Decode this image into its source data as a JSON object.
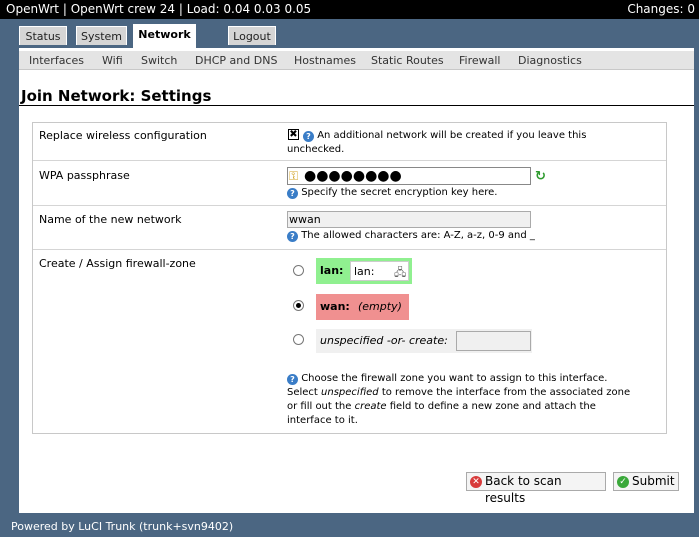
{
  "header": {
    "title": "OpenWrt | OpenWrt crew 24 | Load: 0.04 0.03 0.05",
    "changes": "Changes: 0"
  },
  "tabs": [
    {
      "label": "Status",
      "active": false
    },
    {
      "label": "System",
      "active": false
    },
    {
      "label": "Network",
      "active": true
    },
    {
      "label": "Logout",
      "active": false
    }
  ],
  "subnav": [
    "Interfaces",
    "Wifi",
    "Switch",
    "DHCP and DNS",
    "Hostnames",
    "Static Routes",
    "Firewall",
    "Diagnostics"
  ],
  "page_title": "Join Network: Settings",
  "form": {
    "replace": {
      "label": "Replace wireless configuration",
      "checked": true,
      "check_mark": "✖",
      "help_line1": "An additional network will be created if you leave this",
      "help_line2": "unchecked."
    },
    "wpa": {
      "label": "WPA passphrase",
      "value_masked": "●●●●●●●●",
      "help": "Specify the secret encryption key here."
    },
    "network_name": {
      "label": "Name of the new network",
      "value": "wwan",
      "help": "The allowed characters are: A-Z, a-z, 0-9 and _"
    },
    "firewall": {
      "label": "Create / Assign firewall-zone",
      "lan_label": "lan:",
      "lan_value": "lan:",
      "wan_label": "wan:",
      "wan_value": "(empty)",
      "unspec_label": "unspecified -or- create:",
      "selected": "wan",
      "help_line1": "Choose the firewall zone you want to assign to this interface.",
      "help_line2_pre": "Select ",
      "help_line2_em": "unspecified",
      "help_line2_post": " to remove the interface from the associated zone",
      "help_line3_pre": "or fill out the ",
      "help_line3_em": "create",
      "help_line3_post": " field to define a new zone and attach the",
      "help_line4": "interface to it."
    }
  },
  "buttons": {
    "back": "Back to scan results",
    "submit": "Submit"
  },
  "footer": "Powered by LuCI Trunk (trunk+svn9402)",
  "colors": {
    "lan_zone": "#90f090",
    "wan_zone": "#f09090",
    "help_icon": "#3a7dc7"
  }
}
